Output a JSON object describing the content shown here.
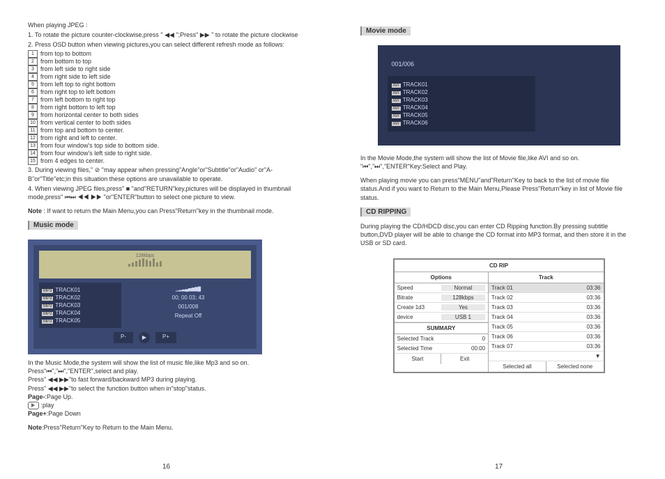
{
  "left": {
    "jpeg_head": "When playing JPEG :",
    "j1": "1. To rotate the picture counter-clockwise,press \" ◀◀ \";Press\" ▶▶ \" to rotate the picture clockwise",
    "j2": "2. Press OSD button when viewing pictures,you can select different refresh mode as follows:",
    "modes": {
      "n1": "1",
      "t1": "from top to bottom",
      "n2": "2",
      "t2": "from bottom to top",
      "n3": "3",
      "t3": "from left side to right side",
      "n4": "4",
      "t4": "from right side to left side",
      "n5": "5",
      "t5": "from left top to right bottom",
      "n6": "6",
      "t6": "from right top to left bottom",
      "n7": "7",
      "t7": "from left bottom to right top",
      "n8": "8",
      "t8": "from right bottom to left top",
      "n9": "9",
      "t9": "from horizontal center to both sides",
      "n10": "10",
      "t10": "from vertical center to both sides",
      "n11": "11",
      "t11": "from top and bottom to center.",
      "n12": "12",
      "t12": "from right and left to center.",
      "n13": "13",
      "t13": "from four window's top side to bottom side.",
      "n14": "14",
      "t14": "from four window's left side to right side.",
      "n15": "15",
      "t15": "from 4 edges to center."
    },
    "j3": "3. During viewing files,\" ⊘ \"may appear when pressing\"Angle\"or\"Subtitle\"or\"Audio\" or\"A-B\"or\"Title\"etc;in this situation these options are unavailable to operate.",
    "j4": "4. When viewing JPEG files,press\" ■ \"and\"RETURN\"key,pictures will be displayed in thumbnail mode,press\" ⏮⏭ ◀◀ ▶▶ \"or\"ENTER\"button to select one picture to view.",
    "note1_b": "Note",
    "note1": " : If want to return the Main Menu,you can Press\"Return\"key in the thumbnail mode.",
    "music_h": "Music mode",
    "lcd_rate": "128kbps",
    "tracks": {
      "t1": "TRACK01",
      "t2": "TRACK02",
      "t3": "TRACK03",
      "t4": "TRACK04",
      "t5": "TRACK05",
      "tag": "MP3"
    },
    "info_time": "00; 00 03; 43",
    "info_idx": "001/008",
    "info_rpt": "Repeat Off",
    "ctrl_prev": "P-",
    "ctrl_play": "▶",
    "ctrl_next": "P+",
    "m1": "In the Music Mode,the system will show the list of music file,like Mp3 and so on.",
    "m2": "Press\"⏮\",\"⏭\",\"ENTER\",select and play.",
    "m3": "Press\" ◀◀ ▶▶\"to fast forward/backward MP3 during playing.",
    "m4": "Press\" ◀◀  ▶▶\"to select the function button when in\"stop\"status.",
    "m5_b": "Page-",
    "m5": ":Page Up.",
    "m6": " :play",
    "m7_b": "Page+",
    "m7": ":Page Down",
    "note2_b": "Note",
    "note2": ":Press\"Return\"Key to Return to the Main Menu.",
    "page": "16"
  },
  "right": {
    "movie_h": "Movie mode",
    "counter": "001/006",
    "tracks": {
      "t1": "TRACK01",
      "t2": "TRACK02",
      "t3": "TRACK03",
      "t4": "TRACK04",
      "t5": "TRACK05",
      "t6": "TRACK06",
      "tag": "AVI"
    },
    "v1": "In the Movie Mode,the system will show the list of Movie file,like AVI and so on.",
    "v2": "\"⏮\",\"⏭\",\"ENTER\"Key:Select and Play.",
    "v3": "When playing movie you can press\"MENU\"and\"Return\"Key to back to the list of movie file status.And if you want to Return to the Main Menu,Please Press\"Return\"key in list of Movie file status.",
    "cd_h": "CD RIPPING",
    "cd1": "During playing the CD/HDCD disc,you can enter CD Ripping function.By pressing subtitle button,DVD player will be able to change the CD format into MP3 format, and then store it in the USB or SD card.",
    "rip": {
      "title": "CD RIP",
      "opt_h": "Options",
      "trk_h": "Track",
      "o1": "Speed",
      "o1v": "Normal",
      "o2": "Bitrate",
      "o2v": "128kbps",
      "o3": "Create  1d3",
      "o3v": "Yes",
      "o4": "device",
      "o4v": "USB 1",
      "tr1": "Track 01",
      "tr2": "Track 02",
      "tr3": "Track 03",
      "tr4": "Track 04",
      "tr5": "Track 05",
      "tr6": "Track 06",
      "tr7": "Track 07",
      "dur": "03:36",
      "sum": "SUMMARY",
      "st": "Selected Track",
      "stv": "0",
      "sti": "Selected Time",
      "stiv": "00:00",
      "b1": "Start",
      "b2": "Exit",
      "b3": "Selected all",
      "b4": "Selected none",
      "more": "▼"
    },
    "page": "17"
  }
}
